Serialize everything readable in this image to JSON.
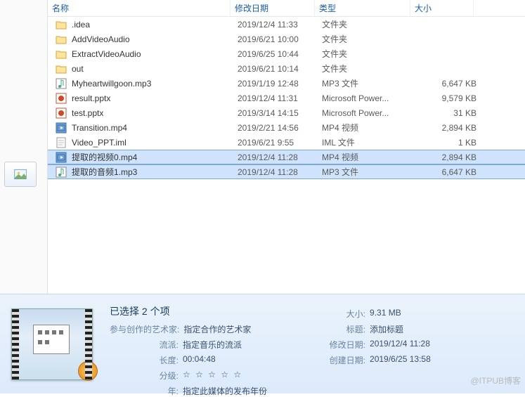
{
  "headers": {
    "name": "名称",
    "date": "修改日期",
    "type": "类型",
    "size": "大小"
  },
  "rows": [
    {
      "icon": "folder",
      "name": ".idea",
      "date": "2019/12/4 11:33",
      "type": "文件夹",
      "size": "",
      "sel": false
    },
    {
      "icon": "folder",
      "name": "AddVideoAudio",
      "date": "2019/6/21 10:00",
      "type": "文件夹",
      "size": "",
      "sel": false
    },
    {
      "icon": "folder",
      "name": "ExtractVideoAudio",
      "date": "2019/6/25 10:44",
      "type": "文件夹",
      "size": "",
      "sel": false
    },
    {
      "icon": "folder",
      "name": "out",
      "date": "2019/6/21 10:14",
      "type": "文件夹",
      "size": "",
      "sel": false
    },
    {
      "icon": "mp3",
      "name": "Myheartwillgoon.mp3",
      "date": "2019/1/19 12:48",
      "type": "MP3 文件",
      "size": "6,647 KB",
      "sel": false
    },
    {
      "icon": "pptx",
      "name": "result.pptx",
      "date": "2019/12/4 11:31",
      "type": "Microsoft Power...",
      "size": "9,579 KB",
      "sel": false
    },
    {
      "icon": "pptx",
      "name": "test.pptx",
      "date": "2019/3/14 14:15",
      "type": "Microsoft Power...",
      "size": "31 KB",
      "sel": false
    },
    {
      "icon": "mp4",
      "name": "Transition.mp4",
      "date": "2019/2/21 14:56",
      "type": "MP4 视频",
      "size": "2,894 KB",
      "sel": false
    },
    {
      "icon": "iml",
      "name": "Video_PPT.iml",
      "date": "2019/6/21 9:55",
      "type": "IML 文件",
      "size": "1 KB",
      "sel": false
    },
    {
      "icon": "mp4",
      "name": "提取的视频0.mp4",
      "date": "2019/12/4 11:28",
      "type": "MP4 视频",
      "size": "2,894 KB",
      "sel": true
    },
    {
      "icon": "mp3",
      "name": "提取的音频1.mp3",
      "date": "2019/12/4 11:28",
      "type": "MP3 文件",
      "size": "6,647 KB",
      "sel": true
    }
  ],
  "details": {
    "title": "已选择 2 个项",
    "left": [
      {
        "lbl": "参与创作的艺术家:",
        "val": "指定合作的艺术家"
      },
      {
        "lbl": "流派:",
        "val": "指定音乐的流派"
      },
      {
        "lbl": "长度:",
        "val": "00:04:48"
      },
      {
        "lbl": "分级:",
        "val": "☆ ☆ ☆ ☆ ☆",
        "stars": true
      },
      {
        "lbl": "年:",
        "val": "指定此媒体的发布年份"
      }
    ],
    "right": [
      {
        "lbl": "大小:",
        "val": "9.31 MB"
      },
      {
        "lbl": "标题:",
        "val": "添加标题"
      },
      {
        "lbl": "修改日期:",
        "val": "2019/12/4 11:28"
      },
      {
        "lbl": "创建日期:",
        "val": "2019/6/25 13:58"
      }
    ]
  },
  "watermark": "@ITPUB博客"
}
